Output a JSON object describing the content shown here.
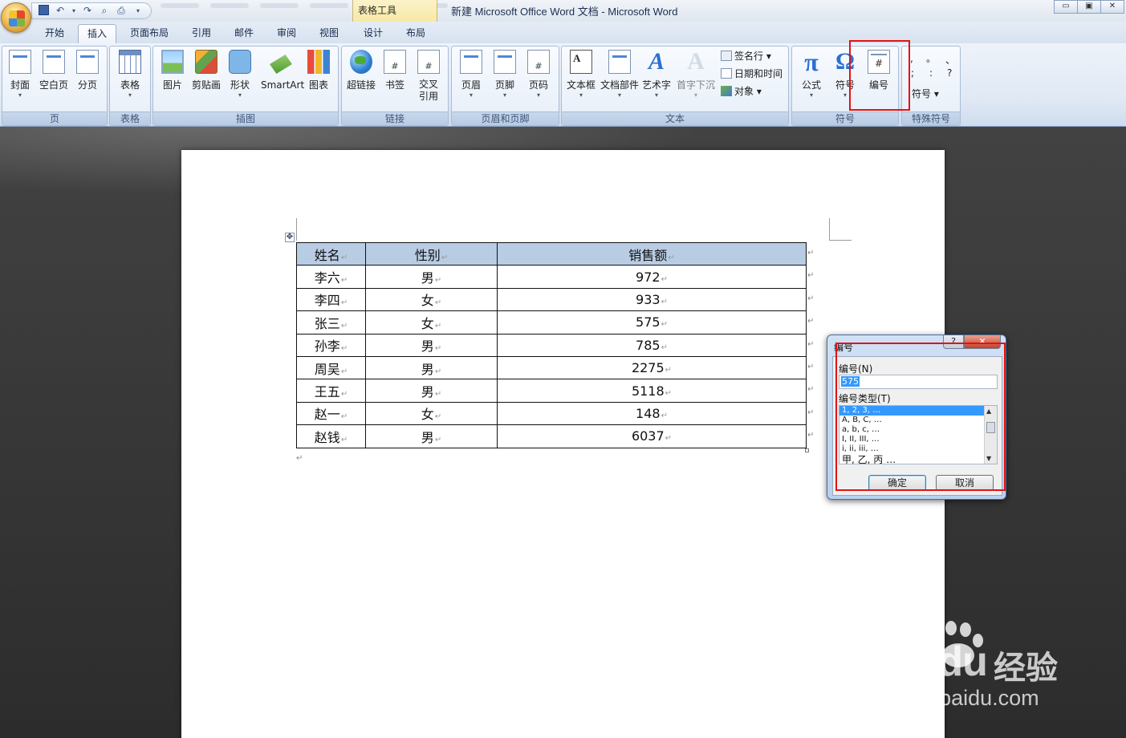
{
  "window": {
    "title": "新建 Microsoft Office Word 文档 - Microsoft Word",
    "context_group": "表格工具",
    "controls": [
      "▭",
      "▣",
      "✕"
    ]
  },
  "tabs": [
    {
      "label": "开始"
    },
    {
      "label": "插入"
    },
    {
      "label": "页面布局"
    },
    {
      "label": "引用"
    },
    {
      "label": "邮件"
    },
    {
      "label": "审阅"
    },
    {
      "label": "视图"
    },
    {
      "label": "设计"
    },
    {
      "label": "布局"
    }
  ],
  "ribbon": {
    "groups": [
      {
        "label": "页"
      },
      {
        "label": "表格"
      },
      {
        "label": "插图"
      },
      {
        "label": "链接"
      },
      {
        "label": "页眉和页脚"
      },
      {
        "label": "文本"
      },
      {
        "label": "符号"
      },
      {
        "label": "特殊符号"
      }
    ],
    "buttons": {
      "cover": "封面",
      "blank": "空白页",
      "break": "分页",
      "table": "表格",
      "picture": "图片",
      "clipart": "剪贴画",
      "shapes": "形状",
      "smartart": "SmartArt",
      "chart": "图表",
      "hyperlink": "超链接",
      "bookmark": "书签",
      "crossref": "交叉\n引用",
      "header": "页眉",
      "footer": "页脚",
      "pagenum": "页码",
      "textbox": "文本框",
      "quickparts": "文档部件",
      "wordart": "艺术字",
      "dropcap": "首字下沉",
      "signature": "签名行",
      "datetime": "日期和时间",
      "object": "对象",
      "equation": "公式",
      "symbol": "符号",
      "number": "编号",
      "special_symbol": "符号"
    },
    "special_chars": [
      ",",
      "。",
      "、",
      ";",
      ":",
      "?"
    ]
  },
  "table": {
    "headers": [
      "姓名",
      "性别",
      "销售额"
    ],
    "rows": [
      [
        "李六",
        "男",
        "972"
      ],
      [
        "李四",
        "女",
        "933"
      ],
      [
        "张三",
        "女",
        "575"
      ],
      [
        "孙李",
        "男",
        "785"
      ],
      [
        "周吴",
        "男",
        "2275"
      ],
      [
        "王五",
        "男",
        "5118"
      ],
      [
        "赵一",
        "女",
        "148"
      ],
      [
        "赵钱",
        "男",
        "6037"
      ]
    ]
  },
  "dialog": {
    "title": "编号",
    "number_label": "编号(N)",
    "number_value": "575",
    "type_label": "编号类型(T)",
    "types": [
      "1, 2, 3, …",
      "A, B, C, …",
      "a, b, c, …",
      "I, II, III, …",
      "i, ii, iii, …",
      "甲, 乙, 丙 …"
    ],
    "ok": "确定",
    "cancel": "取消",
    "help": "?",
    "close": "✕"
  },
  "watermark": {
    "logo": "Bai du",
    "cn": "经验",
    "url": "jingyan.baidu.com"
  },
  "colors": {
    "table_header": "#b8cce4",
    "annotation_red": "#e41212",
    "selection": "#3399ff"
  }
}
